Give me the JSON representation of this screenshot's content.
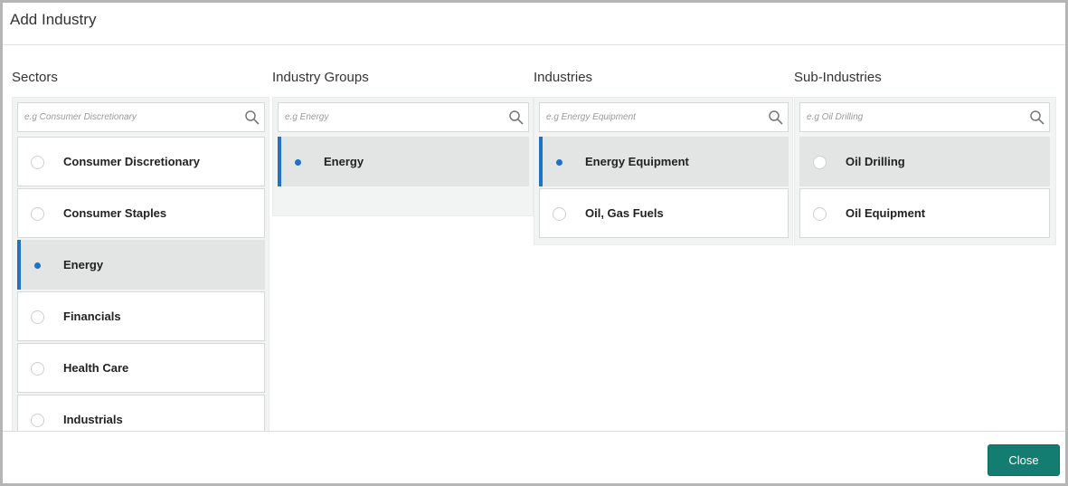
{
  "dialog": {
    "title": "Add Industry",
    "close_label": "Close"
  },
  "columns": {
    "sectors": {
      "title": "Sectors",
      "placeholder": "e.g Consumer Discretionary",
      "items": [
        {
          "label": "Consumer Discretionary",
          "selected": false
        },
        {
          "label": "Consumer Staples",
          "selected": false
        },
        {
          "label": "Energy",
          "selected": true
        },
        {
          "label": "Financials",
          "selected": false
        },
        {
          "label": "Health Care",
          "selected": false
        },
        {
          "label": "Industrials",
          "selected": false
        }
      ]
    },
    "industry_groups": {
      "title": "Industry Groups",
      "placeholder": "e.g Energy",
      "items": [
        {
          "label": "Energy",
          "selected": true
        }
      ]
    },
    "industries": {
      "title": "Industries",
      "placeholder": "e.g Energy Equipment",
      "items": [
        {
          "label": "Energy Equipment",
          "selected": true
        },
        {
          "label": "Oil, Gas Fuels",
          "selected": false
        }
      ]
    },
    "sub_industries": {
      "title": "Sub-Industries",
      "placeholder": "e.g Oil Drilling",
      "items": [
        {
          "label": "Oil Drilling",
          "selected": false
        },
        {
          "label": "Oil Equipment",
          "selected": false
        }
      ]
    }
  },
  "colors": {
    "accent": "#1f72c4",
    "button": "#137d72",
    "selected_bg": "#e3e4e4"
  },
  "icons": {
    "search": "search-icon"
  }
}
